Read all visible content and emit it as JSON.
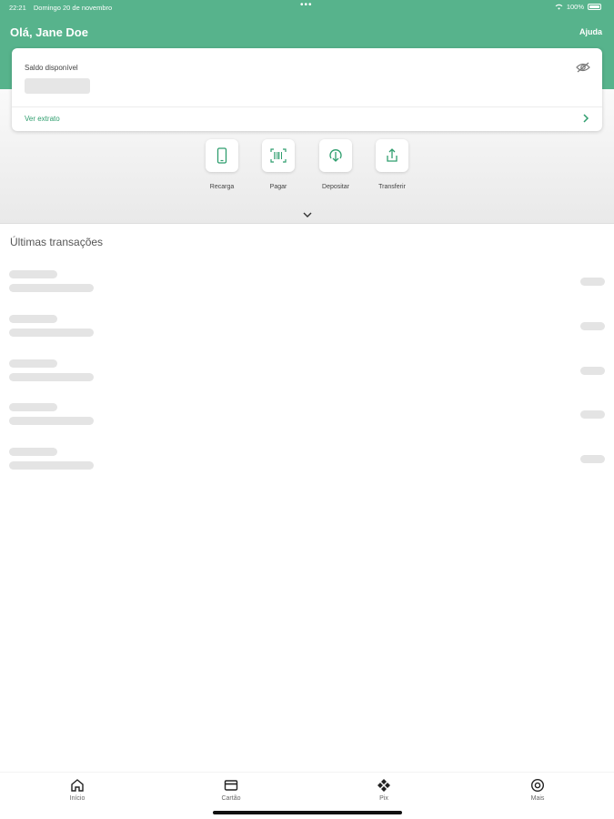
{
  "status_bar": {
    "time": "22:21",
    "date": "Domingo 20 de novembro",
    "dots": "•••",
    "battery": "100%"
  },
  "header": {
    "greeting": "Olá, Jane Doe",
    "help": "Ajuda"
  },
  "balance_card": {
    "label": "Saldo disponível",
    "statement_link": "Ver extrato"
  },
  "quick_actions": [
    {
      "label": "Recarga",
      "icon": "phone-icon"
    },
    {
      "label": "Pagar",
      "icon": "barcode-scan-icon"
    },
    {
      "label": "Depositar",
      "icon": "deposit-icon"
    },
    {
      "label": "Transferir",
      "icon": "transfer-icon"
    }
  ],
  "transactions": {
    "title": "Últimas transações",
    "placeholder_rows": 5
  },
  "bottom_nav": [
    {
      "label": "Início",
      "icon": "home-icon"
    },
    {
      "label": "Cartão",
      "icon": "card-icon"
    },
    {
      "label": "Pix",
      "icon": "pix-icon"
    },
    {
      "label": "Mais",
      "icon": "more-icon"
    }
  ],
  "colors": {
    "brand_green": "#57b38c",
    "link_green": "#2f9e6e",
    "skeleton": "#e4e4e4"
  }
}
